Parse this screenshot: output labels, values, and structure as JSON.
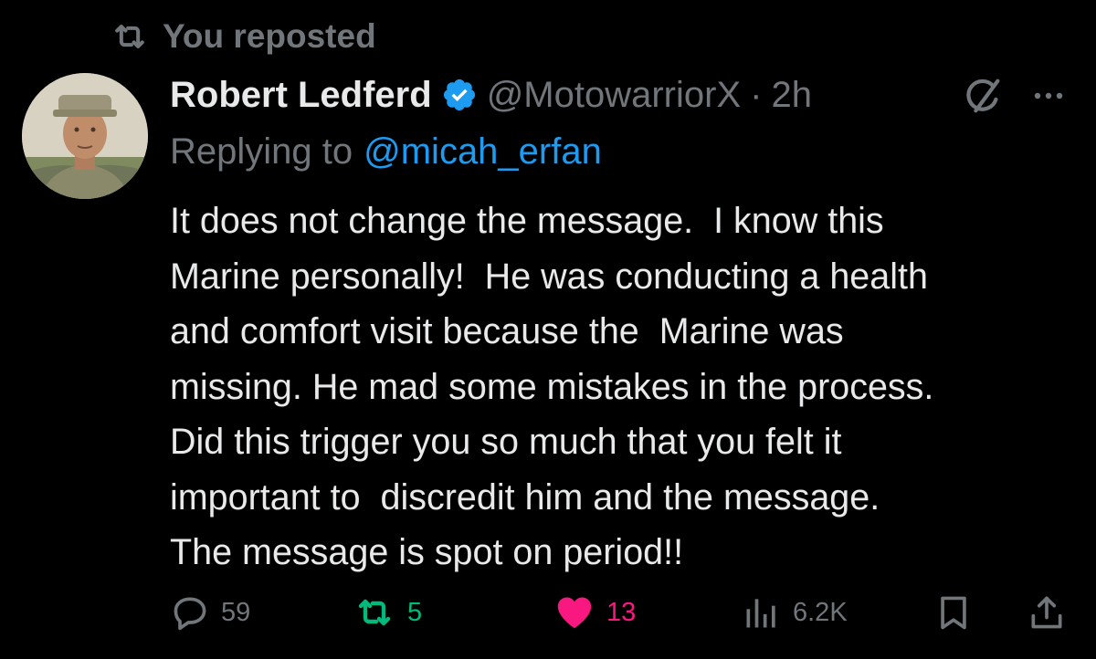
{
  "repost_banner": {
    "icon": "repost-icon",
    "label": "You reposted"
  },
  "author": {
    "display_name": "Robert Ledferd",
    "verified": true,
    "handle": "@MotowarriorX",
    "separator": "·",
    "timestamp": "2h"
  },
  "reply": {
    "prefix": "Replying to",
    "mention": "@micah_erfan"
  },
  "tweet": {
    "lines": [
      "It does not change the message.  I know this",
      "Marine personally!  He was conducting a health",
      "and comfort visit because the  Marine was",
      "missing. He mad some mistakes in the process.",
      "Did this trigger you so much that you felt it",
      "important to  discredit him and the message.",
      "The message is spot on period!!"
    ]
  },
  "actions": {
    "replies": "59",
    "reposts": "5",
    "likes": "13",
    "views": "6.2K"
  },
  "colors": {
    "background": "#000000",
    "text": "#e7e9ea",
    "muted": "#71767b",
    "link": "#1d9bf0",
    "repost_active": "#00ba7c",
    "like_active": "#f91880"
  }
}
